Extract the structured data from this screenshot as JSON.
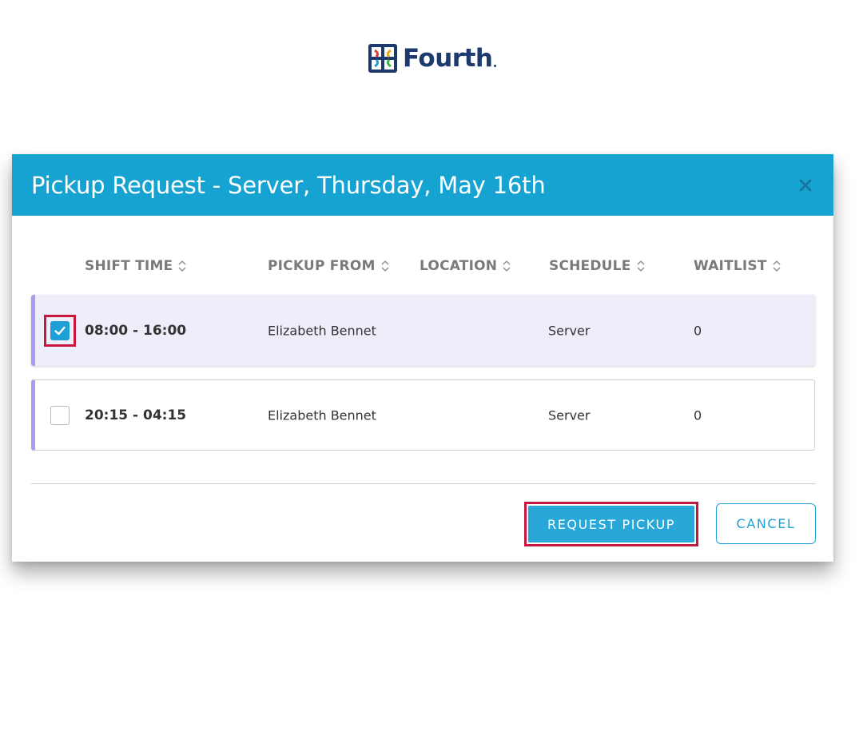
{
  "brand": {
    "name": "Fourth"
  },
  "modal": {
    "title": "Pickup Request - Server, Thursday, May 16th",
    "close_icon": "close-icon"
  },
  "table": {
    "columns": [
      {
        "label": "SHIFT TIME",
        "sortable": true
      },
      {
        "label": "PICKUP FROM",
        "sortable": true
      },
      {
        "label": "LOCATION",
        "sortable": true
      },
      {
        "label": "SCHEDULE",
        "sortable": true
      },
      {
        "label": "WAITLIST",
        "sortable": true
      }
    ],
    "rows": [
      {
        "checked": true,
        "shift_time": "08:00 - 16:00",
        "pickup_from": "Elizabeth Bennet",
        "location": "",
        "schedule": "Server",
        "waitlist": "0"
      },
      {
        "checked": false,
        "shift_time": "20:15 - 04:15",
        "pickup_from": "Elizabeth Bennet",
        "location": "",
        "schedule": "Server",
        "waitlist": "0"
      }
    ]
  },
  "actions": {
    "request_pickup": "REQUEST PICKUP",
    "cancel": "CANCEL"
  },
  "colors": {
    "header_bg": "#17a3d2",
    "accent": "#1e9fd6",
    "highlight": "#c8173f",
    "row_accent": "#a99cf0"
  }
}
